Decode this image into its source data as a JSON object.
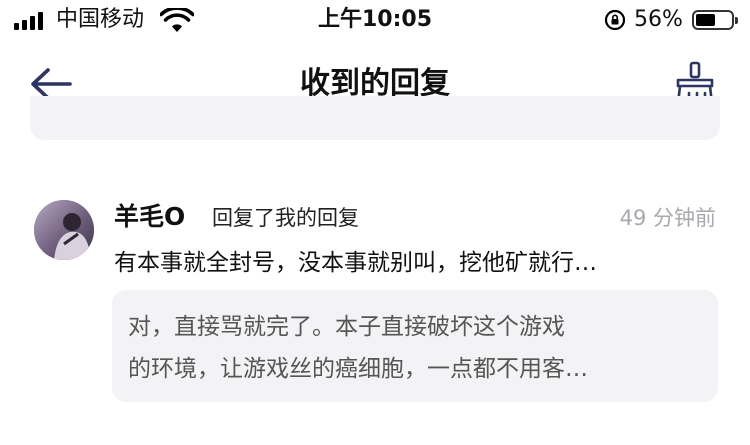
{
  "status_bar": {
    "carrier": "中国移动",
    "time": "上午10:05",
    "battery": "56%",
    "battery_level": 0.56
  },
  "nav": {
    "title": "收到的回复",
    "back_icon": "arrow-left-icon",
    "action_icon": "broom-icon"
  },
  "reply": {
    "username": "羊毛O",
    "action": "回复了我的回复",
    "time": "49 分钟前",
    "content": "有本事就全封号，没本事就别叫，挖他矿就行…",
    "quote_line1": "对，直接骂就完了。本子直接破坏这个游戏",
    "quote_line2": "的环境，让游戏丝的癌细胞，一点都不用客…"
  },
  "colors": {
    "accent": "#2d3560",
    "card_bg": "#f3f3f5",
    "muted_text": "#a8a8ae"
  }
}
